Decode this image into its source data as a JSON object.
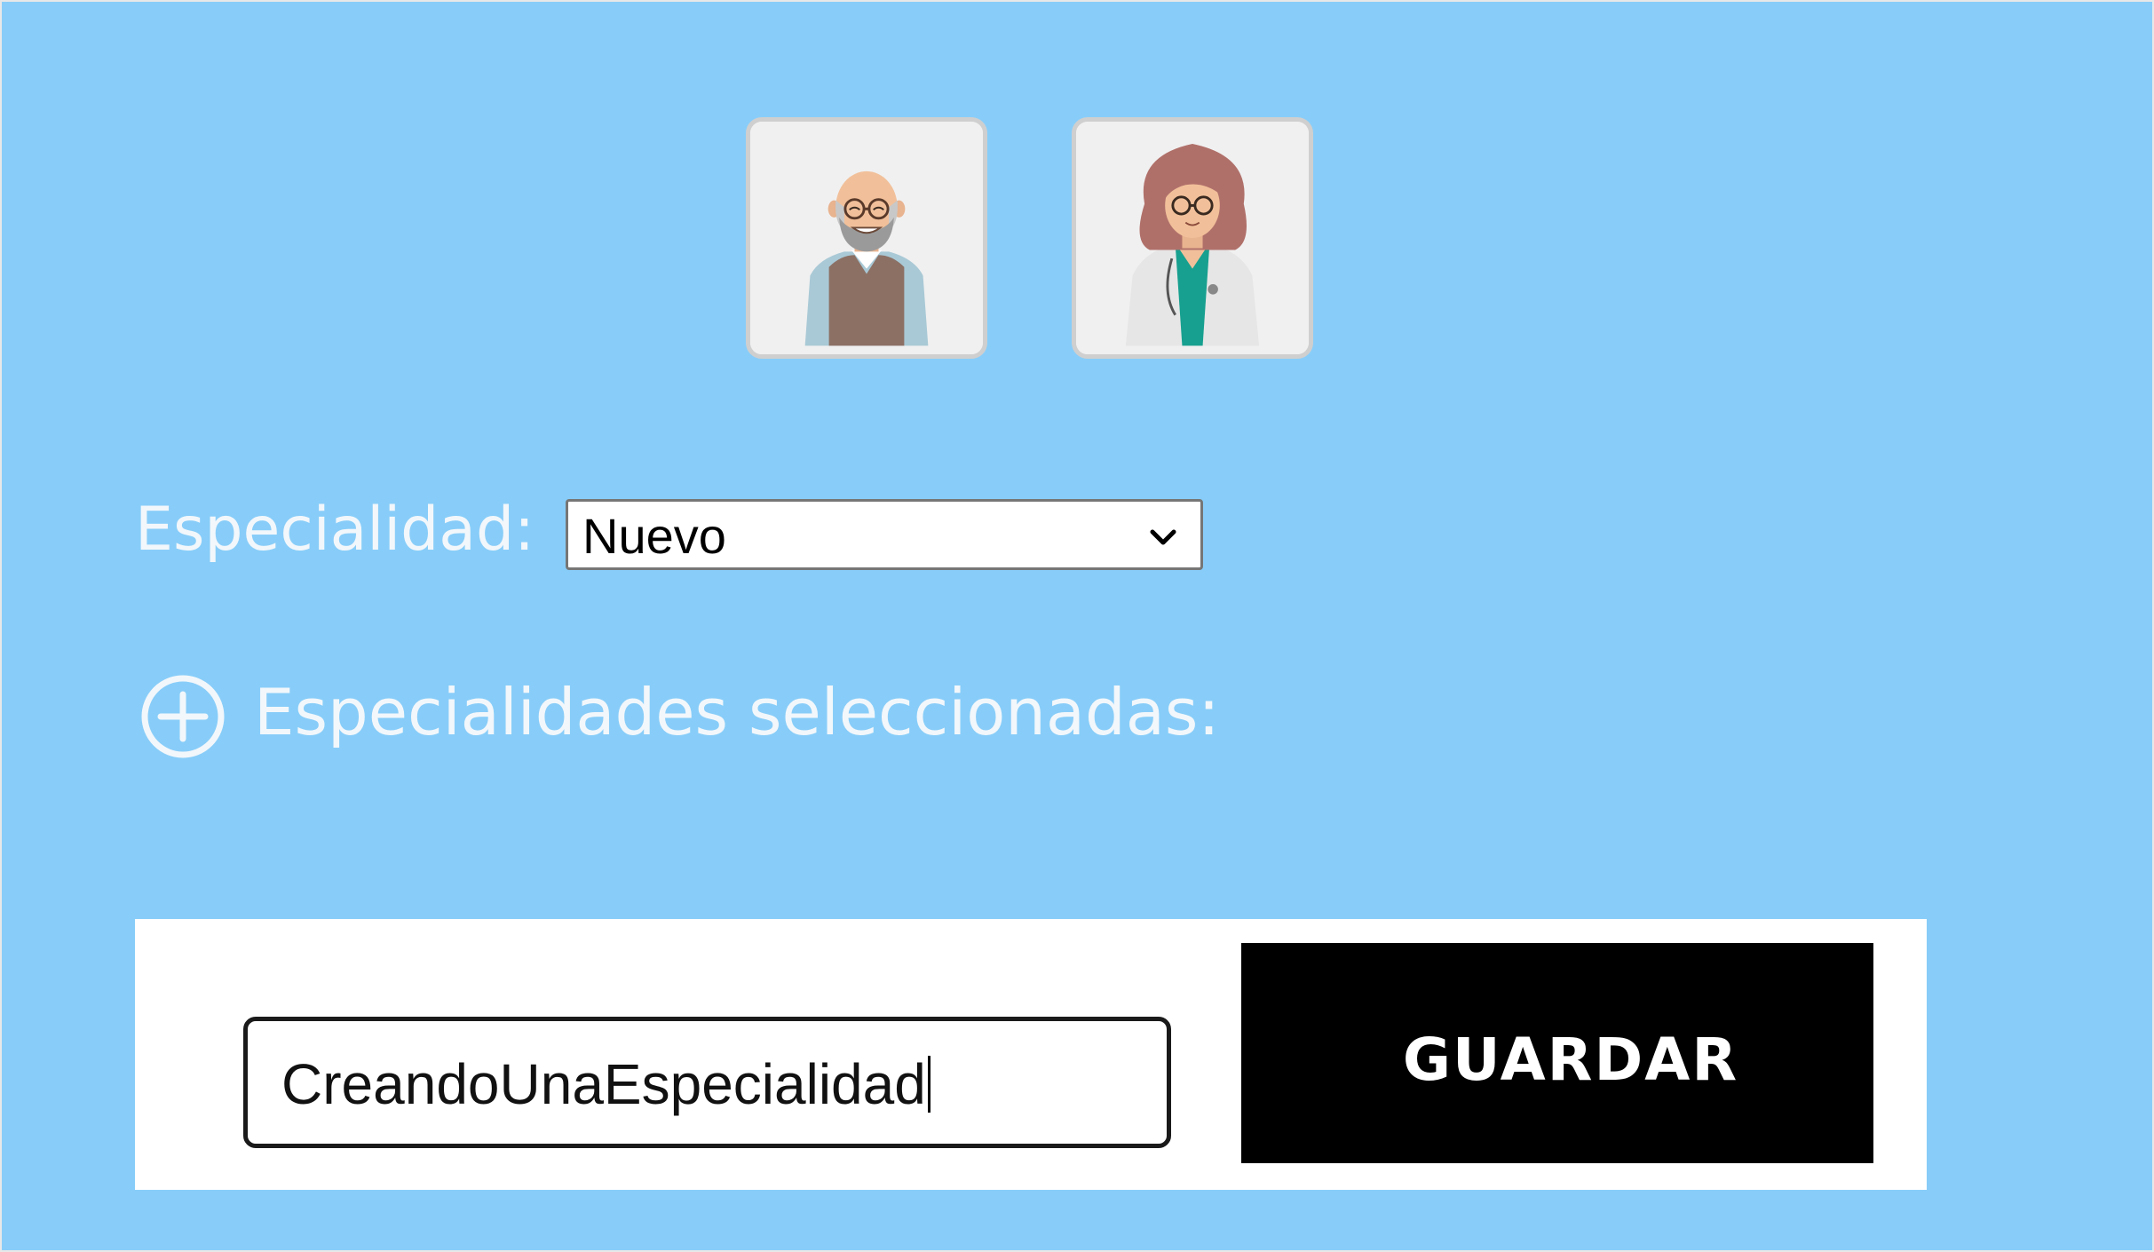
{
  "avatars": [
    {
      "icon": "old-man-patient-avatar-icon"
    },
    {
      "icon": "woman-doctor-avatar-icon"
    }
  ],
  "specialty": {
    "label": "Especialidad:",
    "selected": "Nuevo"
  },
  "selected_specialties": {
    "label": "Especialidades seleccionadas:",
    "icon": "plus-circle-icon"
  },
  "form": {
    "input_value": "CreandoUnaEspecialidad",
    "save_label": "GUARDAR"
  },
  "colors": {
    "background": "#88CDF9",
    "button": "#000000",
    "panel": "#FFFFFF"
  }
}
